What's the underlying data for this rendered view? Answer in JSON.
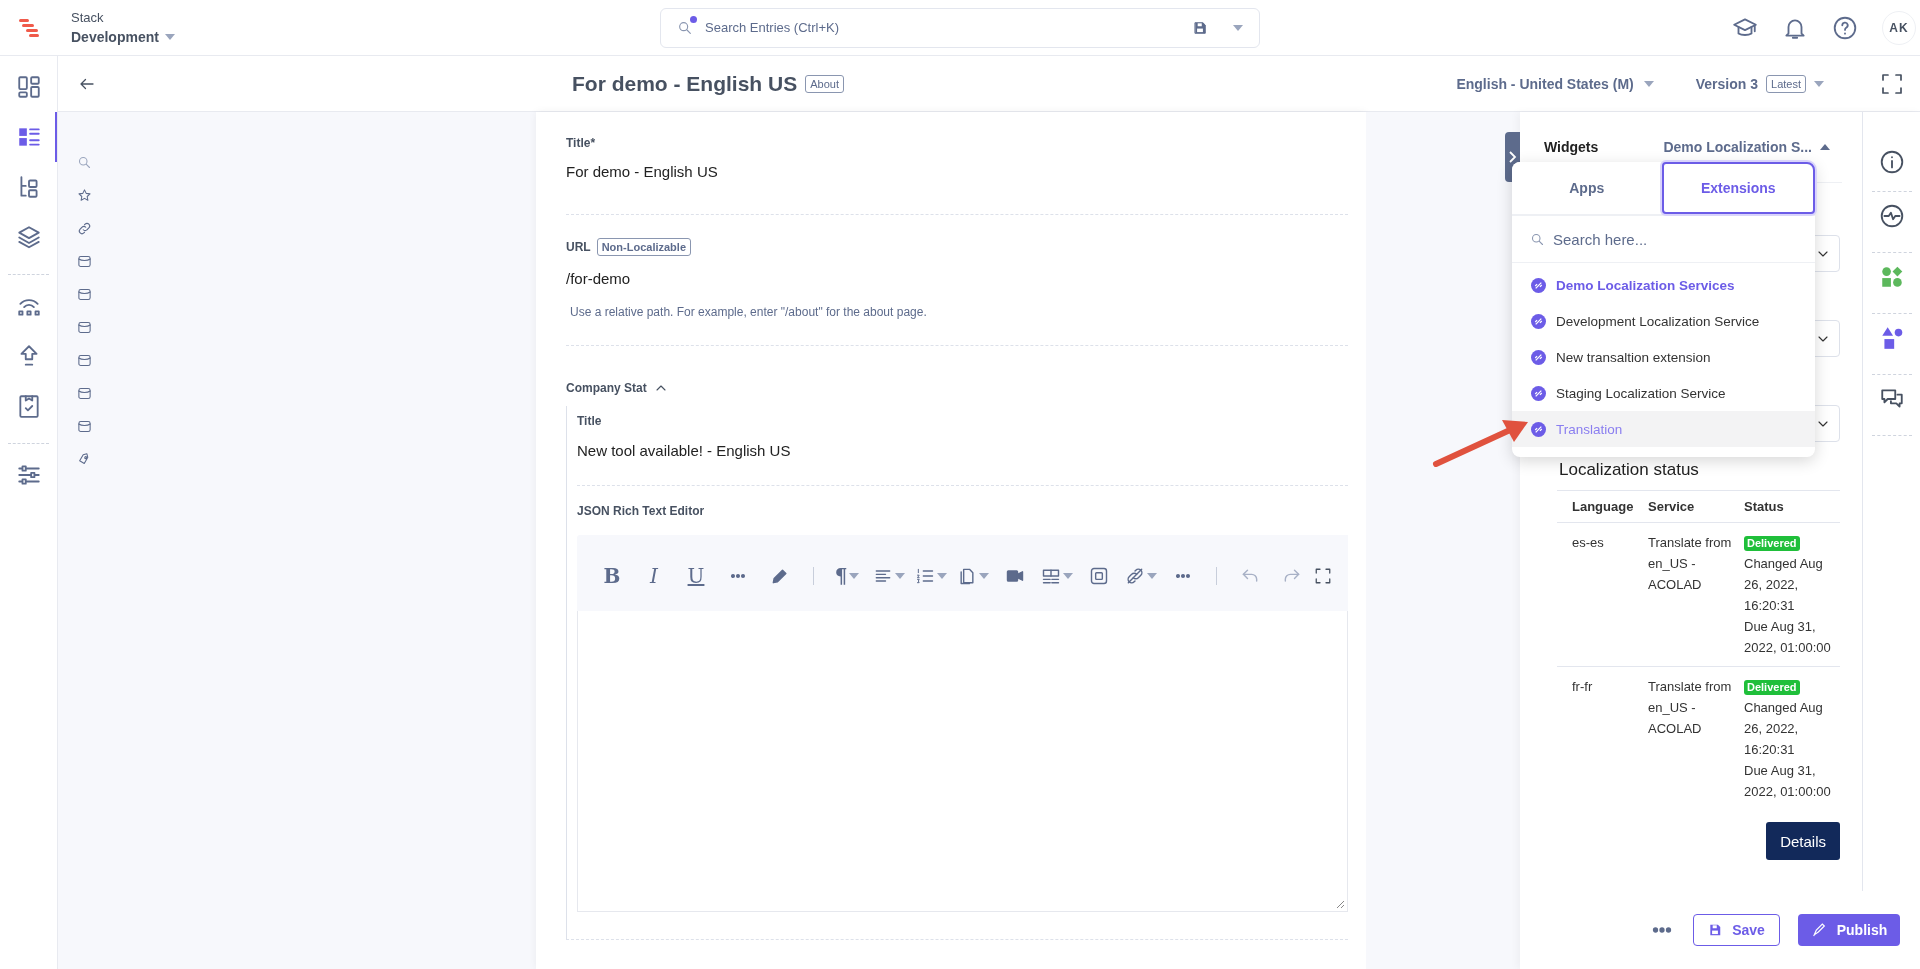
{
  "header": {
    "stack_label": "Stack",
    "stack_name": "Development",
    "search": {
      "placeholder": "Search Entries (Ctrl+K)"
    },
    "avatar": "AK"
  },
  "left_rail": {
    "groups": [
      {
        "items": [
          {
            "kind": "dashboard",
            "selected": false
          },
          {
            "kind": "entries",
            "selected": true
          },
          {
            "kind": "content_models",
            "selected": false
          },
          {
            "kind": "assets",
            "selected": false
          }
        ]
      },
      {
        "items": [
          {
            "kind": "releases",
            "selected": false
          },
          {
            "kind": "deploy",
            "selected": false
          },
          {
            "kind": "tasks",
            "selected": false
          }
        ]
      },
      {
        "items": [
          {
            "kind": "settings",
            "selected": false
          }
        ]
      }
    ]
  },
  "entry": {
    "title": "For demo - English US",
    "badge": "About",
    "locale": "English - United States (M)",
    "version": "Version 3",
    "version_badge": "Latest"
  },
  "sidebar": {
    "items": [
      {
        "kind": "search"
      },
      {
        "kind": "star"
      },
      {
        "kind": "link"
      },
      {
        "kind": "content_type"
      },
      {
        "kind": "content_type"
      },
      {
        "kind": "content_type"
      },
      {
        "kind": "content_type"
      },
      {
        "kind": "content_type"
      },
      {
        "kind": "content_type"
      },
      {
        "kind": "tag"
      }
    ]
  },
  "form": {
    "fields": [
      {
        "kind": "text",
        "label": "Title*",
        "value": "For demo - English US"
      },
      {
        "kind": "url",
        "label": "URL",
        "badge": "Non-Localizable",
        "value": "/for-demo",
        "help": "Use a relative path. For example, enter \"/about\" for the about page."
      },
      {
        "kind": "group",
        "label": "Company Stat",
        "expanded": true,
        "fields": [
          {
            "kind": "text",
            "label": "Title",
            "value": "New tool available! - English US"
          },
          {
            "kind": "rte",
            "label": "JSON Rich Text Editor",
            "toolbar": [
              {
                "kind": "bold",
                "glyph": "B",
                "dropdown": false
              },
              {
                "kind": "italic",
                "glyph": "I",
                "dropdown": false
              },
              {
                "kind": "underline",
                "glyph": "U",
                "dropdown": false
              },
              {
                "kind": "more",
                "dropdown": false
              },
              {
                "kind": "pen",
                "dropdown": false
              },
              {
                "kind": "separator"
              },
              {
                "kind": "paragraph",
                "glyph": "¶",
                "dropdown": true
              },
              {
                "kind": "align",
                "dropdown": true
              },
              {
                "kind": "list",
                "dropdown": true
              },
              {
                "kind": "copy",
                "dropdown": true
              },
              {
                "kind": "video",
                "dropdown": false
              },
              {
                "kind": "table",
                "dropdown": true
              },
              {
                "kind": "embed",
                "dropdown": false
              },
              {
                "kind": "unlink",
                "dropdown": true
              },
              {
                "kind": "more",
                "dropdown": false
              },
              {
                "kind": "separator"
              },
              {
                "kind": "undo",
                "dropdown": false
              },
              {
                "kind": "redo",
                "dropdown": false
              }
            ]
          }
        ]
      }
    ]
  },
  "widgets": {
    "label": "Widgets",
    "value": "Demo Localization S...",
    "expanded": true
  },
  "popup": {
    "tabs": [
      {
        "label": "Apps",
        "selected": false
      },
      {
        "label": "Extensions",
        "selected": true
      }
    ],
    "search_placeholder": "Search here...",
    "items": [
      {
        "label": "Demo Localization Services",
        "selected": true,
        "highlighted": false
      },
      {
        "label": "Development Localization Service",
        "selected": false,
        "highlighted": false
      },
      {
        "label": "New transaltion extension",
        "selected": false,
        "highlighted": false
      },
      {
        "label": "Staging Localization Service",
        "selected": false,
        "highlighted": false
      },
      {
        "label": "Translation",
        "selected": false,
        "highlighted": true
      }
    ]
  },
  "localization": {
    "title": "Localization status",
    "columns": [
      "Language",
      "Service",
      "Status"
    ],
    "rows": [
      {
        "language": "es-es",
        "service": "Translate from en_US - ACOLAD",
        "status": "Delivered",
        "color": "#1fbf3a",
        "changed": "Changed Aug 26, 2022, 16:20:31",
        "due": "Due Aug 31, 2022, 01:00:00"
      },
      {
        "language": "fr-fr",
        "service": "Translate from en_US - ACOLAD",
        "status": "Delivered",
        "color": "#1fbf3a",
        "changed": "Changed Aug 26, 2022, 16:20:31",
        "due": "Due Aug 31, 2022, 01:00:00"
      }
    ],
    "details_button": "Details"
  },
  "right_rail": {
    "items": [
      {
        "kind": "info"
      },
      {
        "kind": "activity"
      },
      {
        "kind": "marketplace"
      },
      {
        "kind": "shapes"
      },
      {
        "kind": "comments"
      }
    ]
  },
  "footer": {
    "save": "Save",
    "publish": "Publish"
  }
}
